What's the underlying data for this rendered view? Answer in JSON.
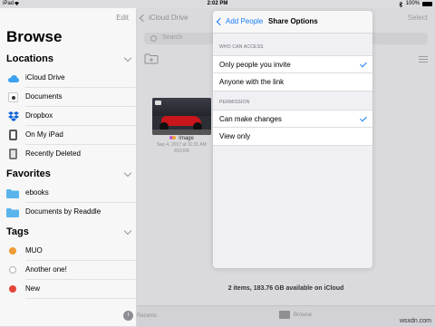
{
  "status_bar": {
    "device": "iPad",
    "time": "2:02 PM",
    "battery": "100%"
  },
  "sidebar": {
    "edit_label": "Edit",
    "title": "Browse",
    "locations": {
      "header": "Locations",
      "items": [
        {
          "label": "iCloud Drive",
          "icon": "icloud-icon"
        },
        {
          "label": "Documents",
          "icon": "documents-app-icon"
        },
        {
          "label": "Dropbox",
          "icon": "dropbox-icon"
        },
        {
          "label": "On My iPad",
          "icon": "ipad-icon"
        },
        {
          "label": "Recently Deleted",
          "icon": "trash-icon"
        }
      ]
    },
    "favorites": {
      "header": "Favorites",
      "items": [
        {
          "label": "ebooks",
          "icon": "folder-icon"
        },
        {
          "label": "Documents by Readdle",
          "icon": "folder-icon"
        }
      ]
    },
    "tags": {
      "header": "Tags",
      "items": [
        {
          "label": "MUO",
          "color": "#f09a37"
        },
        {
          "label": "Another one!",
          "color": "#ffffff"
        },
        {
          "label": "New",
          "color": "#e5453b"
        }
      ]
    }
  },
  "main": {
    "back_label": "iCloud Drive",
    "select_label": "Select",
    "search_placeholder": "Search",
    "file": {
      "name": "Image",
      "date": "Sep 4, 2017 at 11:31 AM",
      "size": "810 KB"
    },
    "storage_text": "2 items, 183.76 GB available on iCloud"
  },
  "tab_bar": {
    "recents_label": "Recents",
    "browse_label": "Browse"
  },
  "share_options": {
    "back_label": "Add People",
    "title": "Share Options",
    "access_header": "WHO CAN ACCESS",
    "access_options": [
      {
        "label": "Only people you invite",
        "selected": true
      },
      {
        "label": "Anyone with the link",
        "selected": false
      }
    ],
    "permission_header": "PERMISSION",
    "permission_options": [
      {
        "label": "Can make changes",
        "selected": true
      },
      {
        "label": "View only",
        "selected": false
      }
    ]
  },
  "watermark": "wsxdn.com",
  "colors": {
    "accent": "#1a7cf6",
    "icloud": "#3aa0f0",
    "dropbox": "#0d62d8",
    "folder": "#5ab4ec"
  }
}
